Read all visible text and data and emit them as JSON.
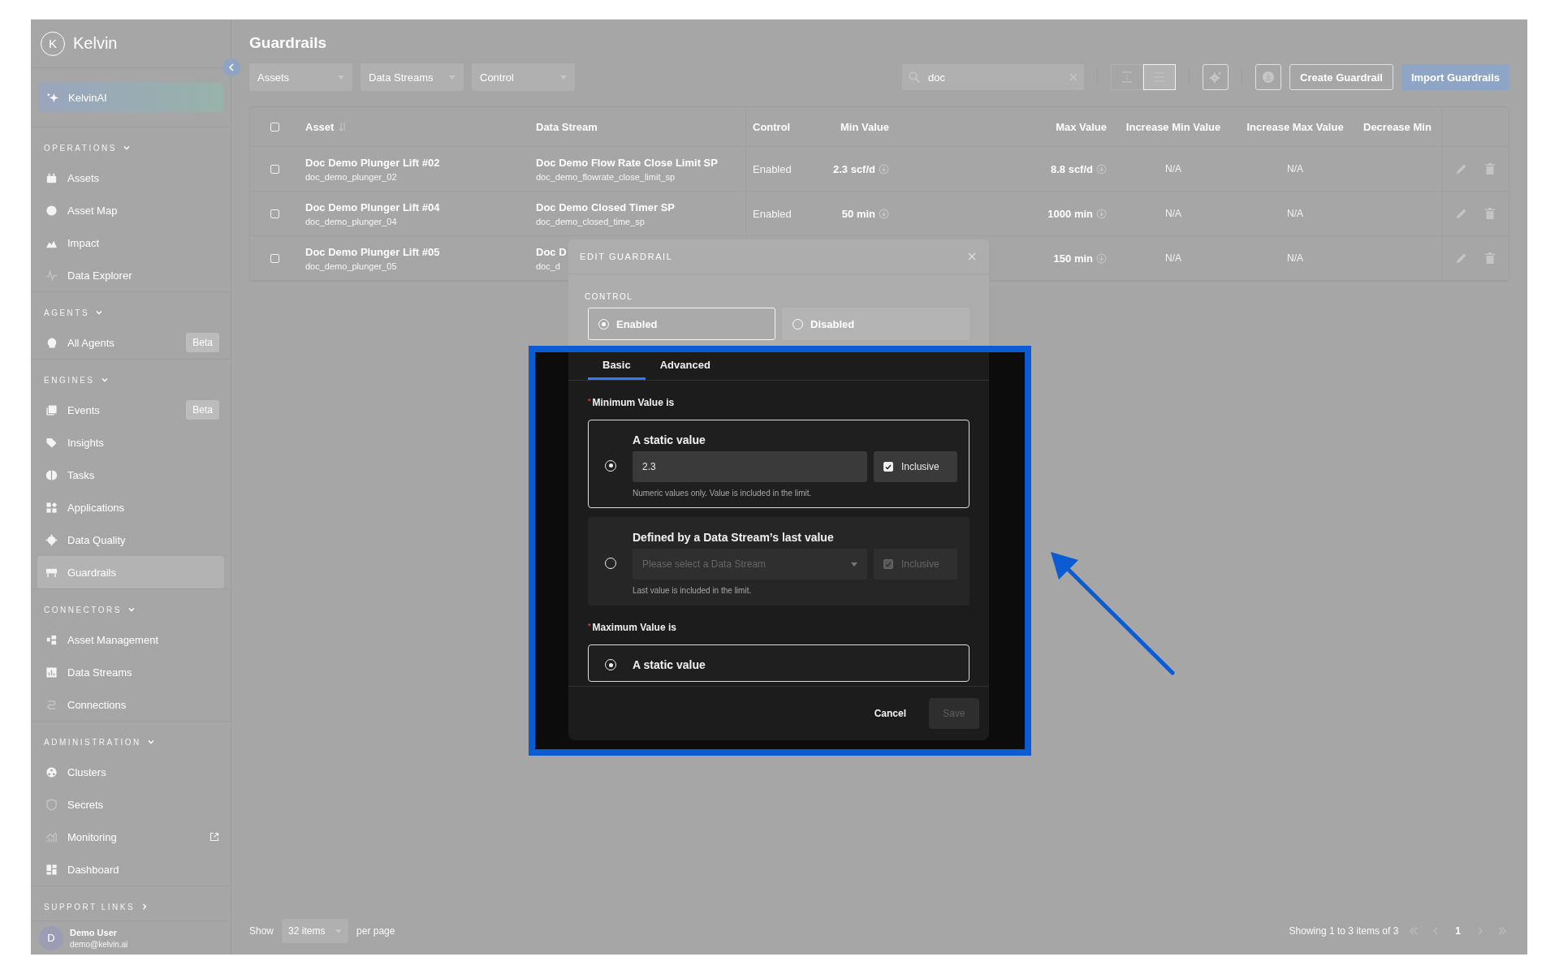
{
  "sidebar": {
    "logo": {
      "mark": "K",
      "name": "Kelvin"
    },
    "ai_button": "KelvinAI",
    "sections": [
      {
        "title": "OPERATIONS",
        "expanded": true,
        "items": [
          {
            "label": "Assets",
            "selected": false
          },
          {
            "label": "Asset Map",
            "selected": false
          },
          {
            "label": "Impact",
            "selected": false
          },
          {
            "label": "Data Explorer",
            "selected": false
          }
        ]
      },
      {
        "title": "AGENTS",
        "expanded": true,
        "items": [
          {
            "label": "All Agents",
            "selected": false,
            "badge": "Beta"
          }
        ]
      },
      {
        "title": "ENGINES",
        "expanded": true,
        "items": [
          {
            "label": "Events",
            "selected": false,
            "badge": "Beta"
          },
          {
            "label": "Insights",
            "selected": false
          },
          {
            "label": "Tasks",
            "selected": false
          },
          {
            "label": "Applications",
            "selected": false
          },
          {
            "label": "Data Quality",
            "selected": false
          },
          {
            "label": "Guardrails",
            "selected": true
          }
        ]
      },
      {
        "title": "CONNECTORS",
        "expanded": true,
        "items": [
          {
            "label": "Asset Management",
            "selected": false
          },
          {
            "label": "Data Streams",
            "selected": false
          },
          {
            "label": "Connections",
            "selected": false
          }
        ]
      },
      {
        "title": "ADMINISTRATION",
        "expanded": true,
        "items": [
          {
            "label": "Clusters",
            "selected": false
          },
          {
            "label": "Secrets",
            "selected": false
          },
          {
            "label": "Monitoring",
            "selected": false,
            "external": true
          },
          {
            "label": "Dashboard",
            "selected": false
          }
        ]
      },
      {
        "title": "SUPPORT LINKS",
        "expanded": false
      }
    ],
    "user": {
      "initial": "D",
      "name": "Demo User",
      "email": "demo@kelvin.ai"
    }
  },
  "main": {
    "title": "Guardrails",
    "filters": [
      "Assets",
      "Data Streams",
      "Control"
    ],
    "search": {
      "value": "doc"
    },
    "view_toggle": [
      {
        "selected": false
      },
      {
        "selected": true
      }
    ],
    "buttons": {
      "create": "Create Guardrail",
      "import": "Import Guardrails"
    },
    "table": {
      "select_all_checked": false,
      "columns": [
        "Asset",
        "Data Stream",
        "Control",
        "Min Value",
        "Max Value",
        "Increase Min Value",
        "Increase Max Value",
        "Decrease Min"
      ],
      "rows": [
        {
          "selected": false,
          "asset": "Doc Demo Plunger Lift #02",
          "asset_id": "doc_demo_plunger_02",
          "stream": "Doc Demo Flow Rate Close Limit SP",
          "stream_id": "doc_demo_flowrate_close_limit_sp",
          "control": "Enabled",
          "min": "2.3 scf/d",
          "max": "8.8 scf/d",
          "increase_min": "N/A",
          "increase_max": "N/A"
        },
        {
          "selected": false,
          "asset": "Doc Demo Plunger Lift #04",
          "asset_id": "doc_demo_plunger_04",
          "stream": "Doc Demo Closed Timer SP",
          "stream_id": "doc_demo_closed_time_sp",
          "control": "Enabled",
          "min": "50 min",
          "max": "1000 min",
          "increase_min": "N/A",
          "increase_max": "N/A"
        },
        {
          "selected": false,
          "asset": "Doc Demo Plunger Lift #05",
          "asset_id": "doc_demo_plunger_05",
          "stream": "Doc D",
          "stream_id": "doc_d",
          "max": "150 min",
          "increase_min": "N/A",
          "increase_max": "N/A"
        }
      ]
    },
    "footer": {
      "show": "Show",
      "page_size": "32 items",
      "per_page": "per page",
      "summary": "Showing 1 to 3 items of 3",
      "pages": [
        {
          "label": "1",
          "selected": true
        }
      ]
    }
  },
  "modal": {
    "title": "EDIT GUARDRAIL",
    "control_label": "CONTROL",
    "control_options": [
      {
        "label": "Enabled",
        "selected": true
      },
      {
        "label": "Disabled",
        "selected": false
      }
    ],
    "tabs": [
      {
        "label": "Basic",
        "selected": true
      },
      {
        "label": "Advanced",
        "selected": false
      }
    ],
    "sections": [
      {
        "label": "Minimum Value is",
        "required_mark": "*",
        "options": [
          {
            "kind": "static",
            "title": "A static value",
            "selected": true,
            "value": "2.3",
            "inclusive": {
              "label": "Inclusive",
              "checked": true,
              "disabled": false
            },
            "hint": "Numeric values only. Value is included in the limit."
          },
          {
            "kind": "stream",
            "title": "Defined by a Data Stream’s last value",
            "selected": false,
            "placeholder": "Please select a Data Stream",
            "inclusive": {
              "label": "Inclusive",
              "checked": true,
              "disabled": true
            },
            "hint": "Last value is included in the limit."
          }
        ]
      },
      {
        "label": "Maximum Value is",
        "required_mark": "*",
        "options": [
          {
            "kind": "static",
            "title": "A static value",
            "selected": true
          }
        ]
      }
    ],
    "cancel": "Cancel",
    "save": {
      "label": "Save",
      "disabled": true
    }
  }
}
